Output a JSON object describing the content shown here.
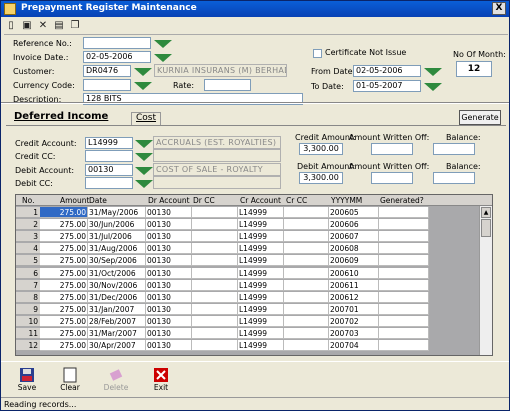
{
  "window": {
    "title": "Prepayment Register Maintenance",
    "close_label": "X"
  },
  "toolbar": {
    "icons": [
      "new-icon",
      "save-icon",
      "delete-icon",
      "print-icon",
      "copy-icon"
    ]
  },
  "header": {
    "reference_label": "Reference No.:",
    "reference_value": "",
    "invoice_date_label": "Invoice Date.:",
    "invoice_date_value": "02-05-2006",
    "customer_label": "Customer:",
    "customer_code": "DR0476",
    "customer_name": "KURNIA INSURANS (M) BERHAD",
    "currency_label": "Currency Code:",
    "currency_value": "",
    "rate_label": "Rate:",
    "rate_value": "",
    "description_label": "Description:",
    "description_value": "128 BITS",
    "certificate_label": "Certificate Not Issue",
    "from_date_label": "From Date:",
    "from_date_value": "02-05-2006",
    "to_date_label": "To Date:",
    "to_date_value": "01-05-2007",
    "no_of_month_label": "No Of Month:",
    "no_of_month_value": "12"
  },
  "tabs": {
    "deferred_income": "Deferred Income",
    "cost": "Cost",
    "generate": "Generate"
  },
  "deferred": {
    "credit_account_label": "Credit Account:",
    "credit_account_value": "L14999",
    "credit_account_name": "ACCRUALS (EST. ROYALTIES)",
    "credit_cc_label": "Credit CC:",
    "credit_cc_value": "",
    "debit_account_label": "Debit Account:",
    "debit_account_value": "00130",
    "debit_account_name": "COST OF SALE - ROYALTY",
    "debit_cc_label": "Debit CC:",
    "debit_cc_value": "",
    "credit_amount_label": "Credit Amount:",
    "credit_amount_value": "3,300.00",
    "debit_amount_label": "Debit Amount:",
    "debit_amount_value": "3,300.00",
    "written_off_label_1": "Amount Written Off:",
    "written_off_label_2": "Amount Written Off:",
    "written_off_value_1": "",
    "written_off_value_2": "",
    "balance_label_1": "Balance:",
    "balance_label_2": "Balance:",
    "balance_value_1": "",
    "balance_value_2": ""
  },
  "grid": {
    "columns": [
      "No.",
      "Amount",
      "Date",
      "Dr Account",
      "Dr CC",
      "Cr Account",
      "Cr CC",
      "YYYYMM",
      "Generated?"
    ],
    "rows": [
      [
        "1",
        "275.00",
        "31/May/2006",
        "00130",
        "",
        "L14999",
        "",
        "200605",
        ""
      ],
      [
        "2",
        "275.00",
        "30/Jun/2006",
        "00130",
        "",
        "L14999",
        "",
        "200606",
        ""
      ],
      [
        "3",
        "275.00",
        "31/Jul/2006",
        "00130",
        "",
        "L14999",
        "",
        "200607",
        ""
      ],
      [
        "4",
        "275.00",
        "31/Aug/2006",
        "00130",
        "",
        "L14999",
        "",
        "200608",
        ""
      ],
      [
        "5",
        "275.00",
        "30/Sep/2006",
        "00130",
        "",
        "L14999",
        "",
        "200609",
        ""
      ],
      [
        "6",
        "275.00",
        "31/Oct/2006",
        "00130",
        "",
        "L14999",
        "",
        "200610",
        ""
      ],
      [
        "7",
        "275.00",
        "30/Nov/2006",
        "00130",
        "",
        "L14999",
        "",
        "200611",
        ""
      ],
      [
        "8",
        "275.00",
        "31/Dec/2006",
        "00130",
        "",
        "L14999",
        "",
        "200612",
        ""
      ],
      [
        "9",
        "275.00",
        "31/Jan/2007",
        "00130",
        "",
        "L14999",
        "",
        "200701",
        ""
      ],
      [
        "10",
        "275.00",
        "28/Feb/2007",
        "00130",
        "",
        "L14999",
        "",
        "200702",
        ""
      ],
      [
        "11",
        "275.00",
        "31/Mar/2007",
        "00130",
        "",
        "L14999",
        "",
        "200703",
        ""
      ],
      [
        "12",
        "275.00",
        "30/Apr/2007",
        "00130",
        "",
        "L14999",
        "",
        "200704",
        ""
      ]
    ]
  },
  "buttons": {
    "save": "Save",
    "clear": "Clear",
    "delete": "Delete",
    "exit": "Exit"
  },
  "status": {
    "text": "Reading records..."
  },
  "colors": {
    "accent_green": "#2e8a3e",
    "title_blue": "#0a5fd8",
    "grid_bg": "#a9a9ab"
  }
}
